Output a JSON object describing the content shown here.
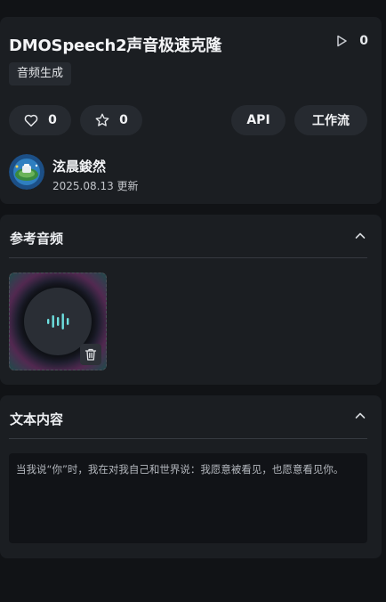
{
  "header": {
    "title": "DMOSpeech2声音极速克隆",
    "play_count": "0",
    "tag": "音频生成"
  },
  "actions": {
    "like_count": "0",
    "favorite_count": "0",
    "api_label": "API",
    "workflow_label": "工作流"
  },
  "author": {
    "name": "泫晨鋑然",
    "updated": "2025.08.13 更新"
  },
  "reference_audio": {
    "title": "参考音频"
  },
  "text_content": {
    "title": "文本内容",
    "value": "当我说“你”时，我在对我自己和世界说：我愿意被看见，也愿意看见你。"
  },
  "colors": {
    "background": "#111316",
    "card": "#1b1e22",
    "pill": "#262a30",
    "wave_accent": "#6ee0e0"
  }
}
